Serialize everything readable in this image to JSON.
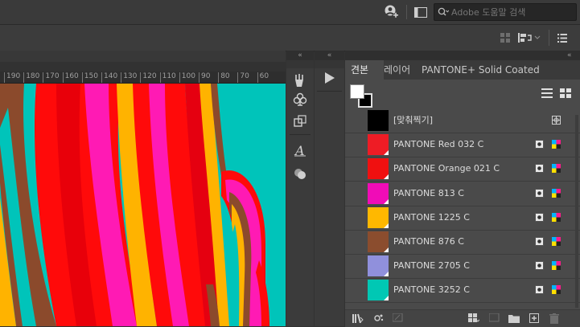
{
  "topbar": {
    "search_placeholder": "Adobe 도움말 검색"
  },
  "collapse_glyph": "«",
  "panel_tabs": [
    {
      "label": "견본",
      "active": true
    },
    {
      "label": "레이어",
      "active": false
    },
    {
      "label": "PANTONE+ Solid Coated",
      "active": false
    }
  ],
  "ruler_ticks": [
    "190",
    "180",
    "170",
    "160",
    "150",
    "140",
    "130",
    "120",
    "110",
    "100",
    "90",
    "80",
    "70",
    "60"
  ],
  "swatches": [
    {
      "name": "[맞춰찍기]",
      "color": "#000000",
      "type": "registration"
    },
    {
      "name": "PANTONE Red 032 C",
      "color": "#ee1c25",
      "type": "spot"
    },
    {
      "name": "PANTONE Orange 021 C",
      "color": "#f01010",
      "type": "spot"
    },
    {
      "name": "PANTONE 813 C",
      "color": "#f00cb7",
      "type": "spot"
    },
    {
      "name": "PANTONE 1225 C",
      "color": "#ffb800",
      "type": "spot"
    },
    {
      "name": "PANTONE 876 C",
      "color": "#8b4d2e",
      "type": "spot"
    },
    {
      "name": "PANTONE 2705 C",
      "color": "#9090dc",
      "type": "spot"
    },
    {
      "name": "PANTONE 3252 C",
      "color": "#00c8b4",
      "type": "spot"
    }
  ],
  "colors": {
    "canvas_bg": "#00c4ba",
    "red": "#ff0a0a",
    "magenta": "#ff1ab4",
    "yellow": "#ffb300",
    "brown": "#8b4a2c",
    "teal": "#00c4ba"
  }
}
